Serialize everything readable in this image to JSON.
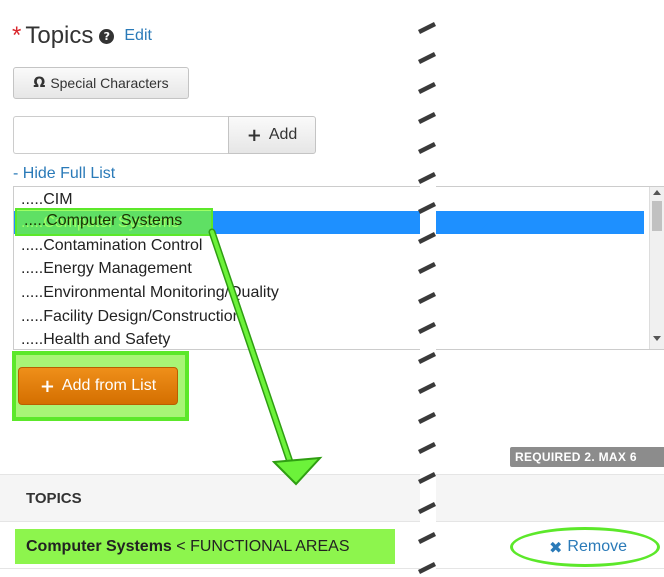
{
  "header": {
    "required_marker": "*",
    "title": "Topics",
    "help_glyph": "?",
    "edit_label": "Edit"
  },
  "special_characters": {
    "glyph": "Ω",
    "label": "Special Characters"
  },
  "add_field": {
    "value": "",
    "placeholder": "",
    "button_label": "Add",
    "button_glyph": "+"
  },
  "hide_full_list_label": "- Hide Full List",
  "topic_list": {
    "items": [
      ".....CIM",
      ".....Computer Systems",
      ".....Contamination Control",
      ".....Energy Management",
      ".....Environmental Monitoring/Quality",
      ".....Facility Design/Construction",
      ".....Health and Safety"
    ],
    "selected_index": 1
  },
  "add_from_list": {
    "glyph": "+",
    "label": "Add from List"
  },
  "badge": "REQUIRED 2. MAX 6",
  "topics_table": {
    "header": "TOPICS",
    "row": {
      "name": "Computer Systems",
      "suffix": " < FUNCTIONAL AREAS",
      "remove_glyph": "✖",
      "remove_label": "Remove"
    }
  },
  "colors": {
    "accent_link": "#2a7ab8",
    "selection": "#1e90ff",
    "highlight_green": "#5ce82a",
    "orange_button": "#e67e0e",
    "required_red": "#d9262c"
  }
}
